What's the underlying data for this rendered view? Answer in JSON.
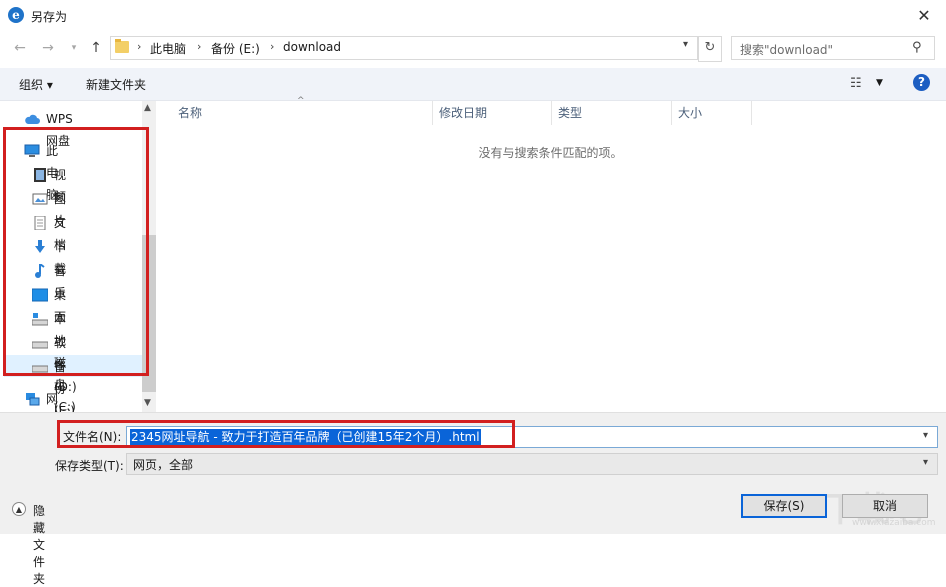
{
  "window": {
    "title": "另存为",
    "close_glyph": "✕"
  },
  "address_bar": {
    "crumbs": [
      "此电脑",
      "备份 (E:)",
      "download"
    ],
    "separator": "›",
    "search_placeholder": "搜索\"download\""
  },
  "toolbar": {
    "organize_label": "组织 ▾",
    "new_folder_label": "新建文件夹",
    "help_glyph": "?"
  },
  "nav_pane": {
    "items": [
      {
        "label": "WPS网盘",
        "icon": "cloud-icon"
      },
      {
        "label": "此电脑",
        "icon": "computer-icon"
      },
      {
        "label": "视频",
        "icon": "video-icon"
      },
      {
        "label": "图片",
        "icon": "pictures-icon"
      },
      {
        "label": "文档",
        "icon": "documents-icon"
      },
      {
        "label": "下载",
        "icon": "download-icon"
      },
      {
        "label": "音乐",
        "icon": "music-icon"
      },
      {
        "label": "桌面",
        "icon": "desktop-icon"
      },
      {
        "label": "本地磁盘 (C:)",
        "icon": "drive-icon"
      },
      {
        "label": "软件 (D:)",
        "icon": "drive-icon"
      },
      {
        "label": "备份 (E:)",
        "icon": "drive-icon"
      },
      {
        "label": "网络",
        "icon": "network-icon"
      }
    ]
  },
  "file_list": {
    "columns": [
      "名称",
      "修改日期",
      "类型",
      "大小"
    ],
    "empty_message": "没有与搜索条件匹配的项。"
  },
  "form": {
    "filename_label": "文件名(N):",
    "filename_value": "2345网址导航 - 致力于打造百年品牌（已创建15年2个月）.html",
    "filetype_label": "保存类型(T):",
    "filetype_value": "网页，全部",
    "hide_folders_label": "隐藏文件夹",
    "save_label": "保存(S)",
    "cancel_label": "取消"
  },
  "watermark": {
    "big": "下载吧",
    "small": "www.xiazaiba.com"
  },
  "colors": {
    "accent": "#0a64d8",
    "highlight_box": "#d21f1f",
    "toolbar_bg": "#f0f3f9"
  }
}
